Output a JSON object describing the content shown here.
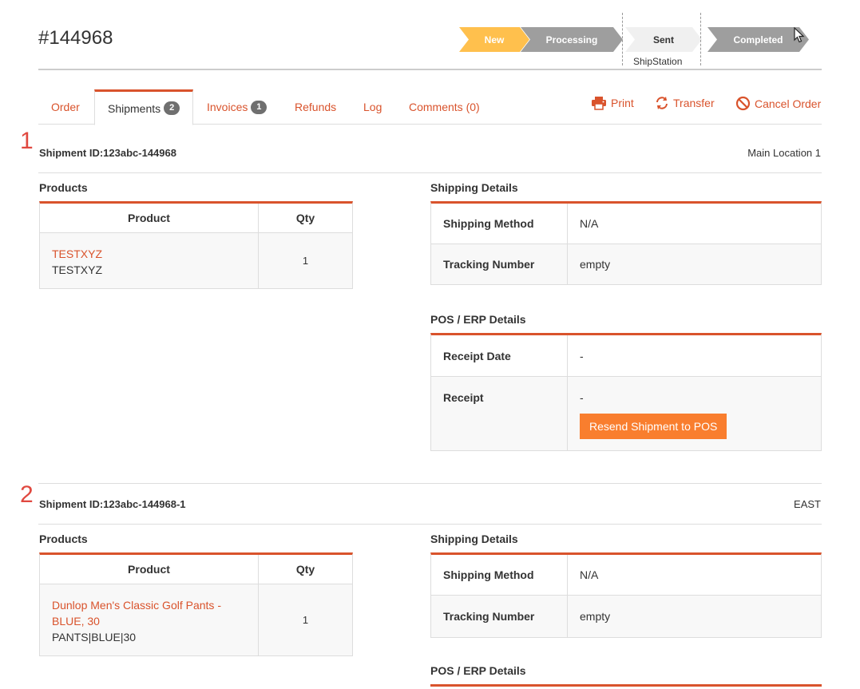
{
  "order": {
    "title": "#144968"
  },
  "pipeline": {
    "stages": [
      {
        "label": "New",
        "color": "#ffc04d"
      },
      {
        "label": "Processing",
        "color": "#9e9e9e"
      },
      {
        "label": "Sent",
        "color": "#f0f0f0"
      },
      {
        "label": "Completed",
        "color": "#9e9e9e"
      }
    ],
    "sub_label": "ShipStation"
  },
  "tabs": [
    {
      "label": "Order"
    },
    {
      "label": "Shipments",
      "badge": "2",
      "active": true
    },
    {
      "label": "Invoices",
      "badge": "1"
    },
    {
      "label": "Refunds"
    },
    {
      "label": "Log"
    },
    {
      "label": "Comments (0)"
    }
  ],
  "actions": {
    "print": "Print",
    "transfer": "Transfer",
    "cancel": "Cancel Order"
  },
  "labels": {
    "products": "Products",
    "product_col": "Product",
    "qty_col": "Qty",
    "shipping_details": "Shipping Details",
    "shipping_method": "Shipping Method",
    "tracking_number": "Tracking Number",
    "pos_erp": "POS / ERP Details",
    "receipt_date": "Receipt Date",
    "receipt": "Receipt",
    "resend_button": "Resend Shipment to POS"
  },
  "shipments": [
    {
      "index": "1",
      "id": "Shipment ID:123abc-144968",
      "location": "Main Location 1",
      "products": [
        {
          "name": "TESTXYZ",
          "sku": "TESTXYZ",
          "qty": "1"
        }
      ],
      "shipping_method": "N/A",
      "tracking_number": "empty",
      "receipt_date": "-",
      "receipt": "-"
    },
    {
      "index": "2",
      "id": "Shipment ID:123abc-144968-1",
      "location": "EAST",
      "products": [
        {
          "name": "Dunlop Men's Classic Golf Pants - BLUE, 30",
          "sku": "PANTS|BLUE|30",
          "qty": "1"
        }
      ],
      "shipping_method": "N/A",
      "tracking_number": "empty"
    }
  ],
  "colors": {
    "accent": "#d9532c",
    "button": "#f97e2e",
    "badge": "#6f6f6f"
  }
}
